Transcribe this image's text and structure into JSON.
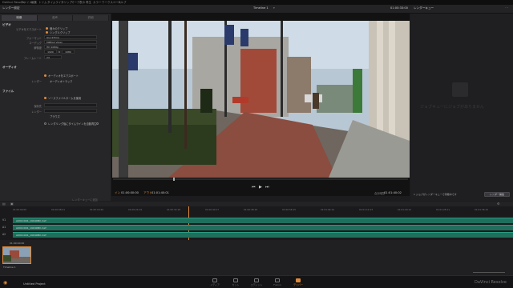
{
  "menubar": {
    "items": [
      "DaVinci Resolve",
      "ファイル",
      "編集",
      "トリム",
      "タイムライン",
      "クリップ",
      "マーク",
      "表示",
      "再生",
      "カラー",
      "ワークスペース",
      "ヘルプ"
    ]
  },
  "topbar": {
    "left_title": "レンダー設定",
    "center_title": "Timeline 1",
    "timecode": "01:00:33:00",
    "right_title": "レンダーキュー"
  },
  "render": {
    "tabs": [
      "映像",
      "音声",
      "詳細"
    ],
    "video_section": "ビデオ",
    "export_video_label": "ビデオをエクスポート",
    "render_mode_label": "個々のクリップ",
    "render_mode_value": "シングルクリップ",
    "format_label": "フォーマット",
    "format_value": "QuickTime",
    "codec_label": "コーデック",
    "codec_value": "MPEG4 Video",
    "resolution_label": "解像度",
    "resolution_value": "HD 1080p",
    "res_w": "1920",
    "res_x": "x",
    "res_h": "1080",
    "framerate_label": "フレームレート",
    "framerate_value": "24",
    "audio_section": "オーディオ",
    "export_audio_label": "オーディオをエクスポート",
    "audio_render_label": "レンダー",
    "audio_render_value": "オーディオトラック",
    "file_section": "ファイル",
    "file_option": "ソースファイルネームを使用",
    "file_location_label": "保存先",
    "render_label": "レンダー",
    "browse": "ブラウズ",
    "queue_checkbox_label": "レンダリング後にタイムラインを自動再生",
    "add_queue": "レンダーキューに追加"
  },
  "viewer": {
    "tc_left_label": "イン",
    "tc_in": "01:00:00:00",
    "tc_out_label": "アウト",
    "tc_out": "01:01:40:01",
    "tc_right": "01:01:40:02",
    "duration_label": "合計時間"
  },
  "queue": {
    "empty_text": "ジョブキューにジョブがありません",
    "status_text": "1 ジョブがレンダーキューで待機中です",
    "render_all": "レンダー開始"
  },
  "timeline": {
    "ruler": [
      "01:00:00:00",
      "01:00:08:21",
      "01:00:16:20",
      "01:00:24:19",
      "01:00:32:18",
      "01:00:40:17",
      "01:00:48:16",
      "01:00:56:15",
      "01:01:04:14",
      "01:01:12:13",
      "01:01:20:12",
      "01:01:28:11",
      "01:01:36:10"
    ],
    "tracks": [
      {
        "name": "V1",
        "clip": "A001C001_190408D.mxf"
      },
      {
        "name": "A1",
        "clip": "A001C001_190408D.mxf"
      },
      {
        "name": "A2",
        "clip": "A001C001_190408D.mxf"
      }
    ],
    "bin_tc": "01:00:00:00",
    "thumb_label": "Timeline 1"
  },
  "pagebar": {
    "project": "Untitled Project",
    "pages": [
      "メディア",
      "カット",
      "エディット",
      "Fusion",
      "カラー",
      "Fairlight",
      "デリバー"
    ],
    "app_name": "DaVinci Resolve"
  },
  "colors": {
    "accent": "#e08a3a",
    "clip": "#1f6f5c"
  }
}
